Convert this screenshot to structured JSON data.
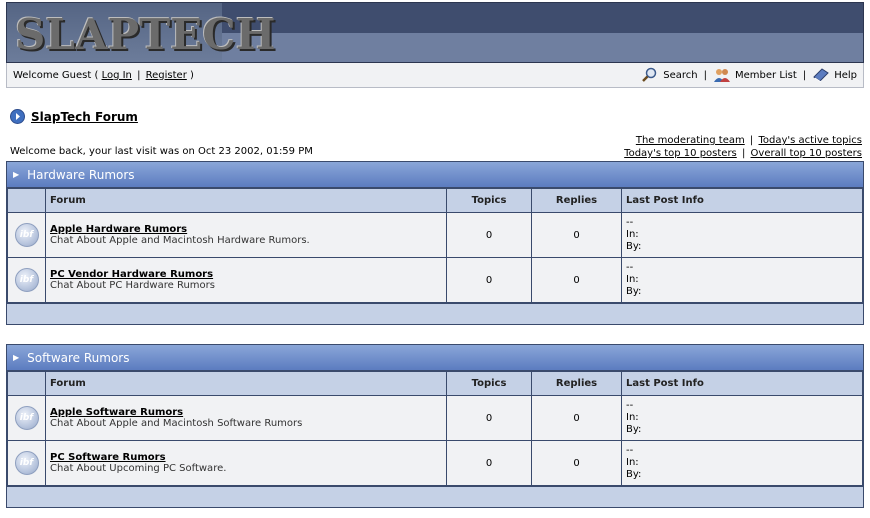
{
  "banner": {
    "logo_text": "SLAPTECH"
  },
  "userbar": {
    "welcome_prefix": "Welcome Guest (",
    "login": "Log In",
    "pipe": "|",
    "register": "Register",
    "welcome_suffix": ")",
    "search": "Search",
    "member_list": "Member List",
    "help": "Help"
  },
  "forum": {
    "title": "SlapTech Forum",
    "welcome_back": "Welcome back, your last visit was on Oct 23 2002, 01:59 PM",
    "links": {
      "moderating_team": "The moderating team",
      "active_topics": "Today's active topics",
      "top10_today": "Today's top 10 posters",
      "top10_overall": "Overall top 10 posters"
    }
  },
  "columns": {
    "forum": "Forum",
    "topics": "Topics",
    "replies": "Replies",
    "last_post": "Last Post Info"
  },
  "icon_text": "ibf",
  "categories": [
    {
      "name": "Hardware Rumors",
      "forums": [
        {
          "name": "Apple Hardware Rumors",
          "desc": "Chat About Apple and Macintosh Hardware Rumors.",
          "topics": "0",
          "replies": "0",
          "last_date": "--",
          "last_in": "In:",
          "last_by": "By:"
        },
        {
          "name": "PC Vendor Hardware Rumors",
          "desc": "Chat About PC Hardware Rumors",
          "topics": "0",
          "replies": "0",
          "last_date": "--",
          "last_in": "In:",
          "last_by": "By:"
        }
      ]
    },
    {
      "name": "Software Rumors",
      "forums": [
        {
          "name": "Apple Software Rumors",
          "desc": "Chat About Apple and Macintosh Software Rumors",
          "topics": "0",
          "replies": "0",
          "last_date": "--",
          "last_in": "In:",
          "last_by": "By:"
        },
        {
          "name": "PC Software Rumors",
          "desc": "Chat About Upcoming PC Software.",
          "topics": "0",
          "replies": "0",
          "last_date": "--",
          "last_in": "In:",
          "last_by": "By:"
        }
      ]
    }
  ]
}
